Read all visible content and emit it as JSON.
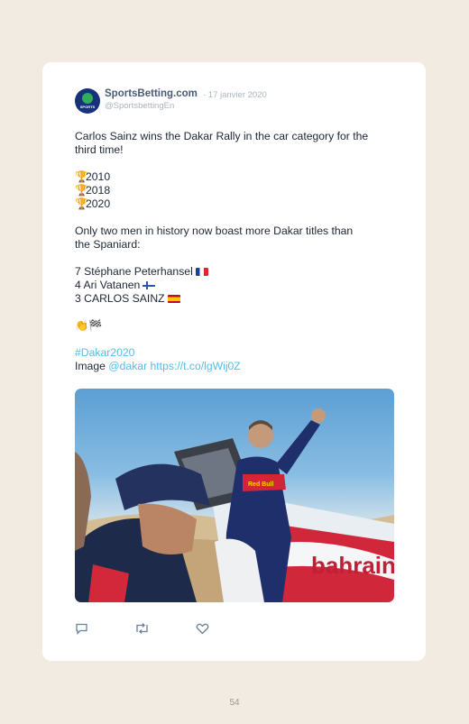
{
  "author": {
    "name": "SportsBetting.com",
    "date": "· 17 janvier 2020",
    "handle": "@SportsbettingEn",
    "avatar_text": "SPORTS"
  },
  "tweet": {
    "intro_line1": "Carlos Sainz wins the Dakar Rally in the car category for the",
    "intro_line2": "third time!",
    "years": [
      "2010",
      "2018",
      "2020"
    ],
    "history_line1": "Only two men in history now boast more Dakar titles than",
    "history_line2": "the Spaniard:",
    "rankings": [
      {
        "text": "7 Stéphane Peterhansel",
        "flag": "flag-fr"
      },
      {
        "text": "4 Ari Vatanen",
        "flag": "flag-fi"
      },
      {
        "text": "3 CARLOS SAINZ",
        "flag": "flag-es"
      }
    ],
    "emoji_line": "👏🏁",
    "hashtag": "#Dakar2020",
    "image_label": "Image",
    "mention": "@dakar",
    "url": "https://t.co/lgWij0Z"
  },
  "photo": {
    "car_branding": "bahrain",
    "sponsor_text": "Red Bull"
  },
  "icons": [
    "reply-icon",
    "retweet-icon",
    "like-icon"
  ],
  "page_number": "54"
}
